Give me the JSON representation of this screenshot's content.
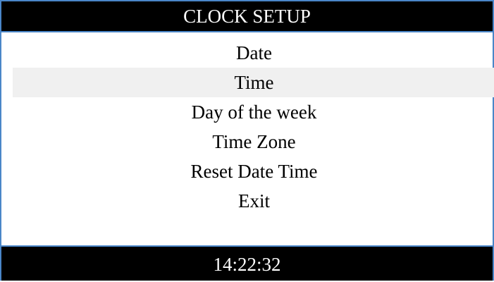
{
  "header": {
    "title": "CLOCK SETUP"
  },
  "menu": {
    "items": [
      {
        "label": "Date",
        "selected": false
      },
      {
        "label": "Time",
        "selected": true
      },
      {
        "label": "Day of the week",
        "selected": false
      },
      {
        "label": "Time Zone",
        "selected": false
      },
      {
        "label": "Reset Date Time",
        "selected": false
      },
      {
        "label": "Exit",
        "selected": false
      }
    ]
  },
  "footer": {
    "clock": "14:22:32"
  },
  "colors": {
    "bar_background": "#000000",
    "bar_text": "#ffffff",
    "frame_border": "#4a86c8",
    "selected_row": "#f0f0f0"
  }
}
